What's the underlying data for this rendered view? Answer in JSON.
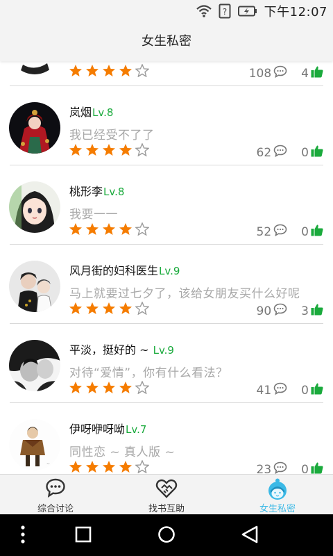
{
  "status_bar": {
    "time": "下午12:07",
    "icons": [
      "wifi-icon",
      "sim-unknown-icon",
      "battery-charging-icon"
    ]
  },
  "header": {
    "title": "女生私密"
  },
  "posts": [
    {
      "name": "",
      "level": "",
      "message": "",
      "rating": 4,
      "max_rating": 5,
      "comments": "108",
      "likes": "4"
    },
    {
      "name": "岚烟",
      "level": "Lv.8",
      "message": "我已经受不了了",
      "rating": 4,
      "max_rating": 5,
      "comments": "62",
      "likes": "0"
    },
    {
      "name": "桃形李",
      "level": "Lv.8",
      "message": "我要一一",
      "rating": 4,
      "max_rating": 5,
      "comments": "52",
      "likes": "0"
    },
    {
      "name": "风月街的妇科医生",
      "level": "Lv.9",
      "message": "马上就要过七夕了，该给女朋友买什么好呢",
      "rating": 4,
      "max_rating": 5,
      "comments": "90",
      "likes": "3"
    },
    {
      "name": "平淡，挺好的 ~ ",
      "level": "Lv.9",
      "message": "对待“爱情”，你有什么看法？",
      "rating": 4,
      "max_rating": 5,
      "comments": "41",
      "likes": "0"
    },
    {
      "name": "伊呀咿呀呦",
      "level": "Lv.7",
      "message": "同性恋 ~ 真人版 ~",
      "rating": 4,
      "max_rating": 5,
      "comments": "23",
      "likes": "0"
    }
  ],
  "tabs": [
    {
      "label": "综合讨论",
      "icon": "chat-bubble-icon",
      "active": false
    },
    {
      "label": "找书互助",
      "icon": "handshake-icon",
      "active": false
    },
    {
      "label": "女生私密",
      "icon": "girl-face-icon",
      "active": true
    }
  ],
  "colors": {
    "accent": "#3bb9e6",
    "level_green": "#1aaa3c",
    "star_orange": "#f57c00",
    "like_green": "#1aaa3c"
  }
}
